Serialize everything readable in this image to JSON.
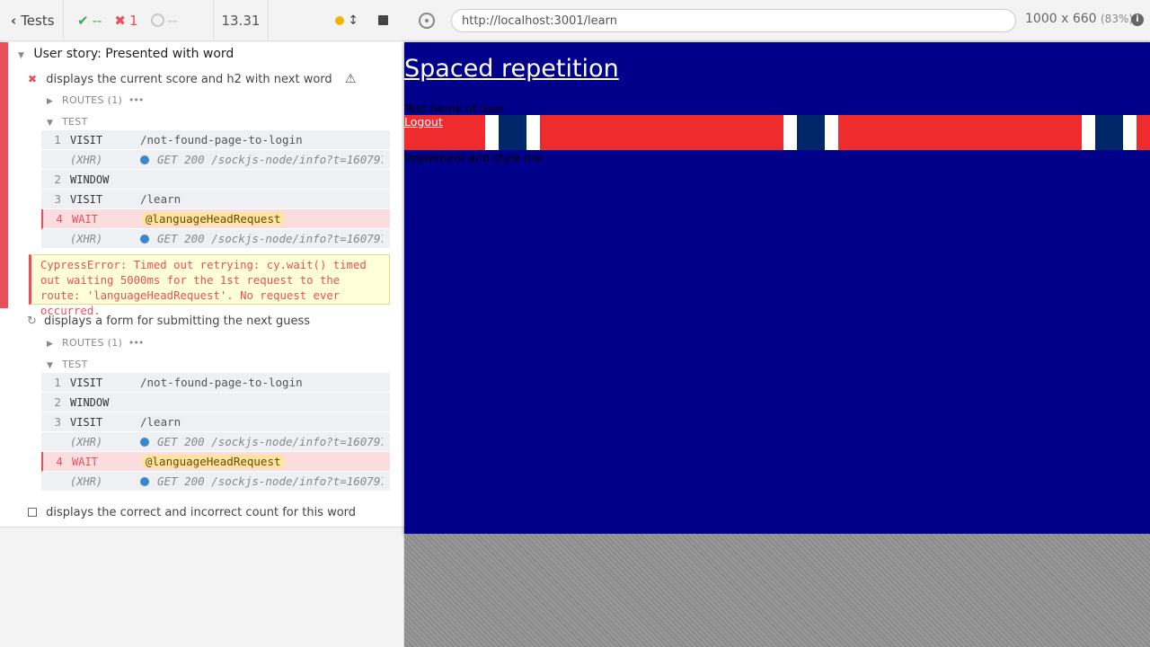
{
  "header": {
    "tests_label": "Tests",
    "passed": "--",
    "failed": "1",
    "pending": "--",
    "duration": "13.31"
  },
  "suite": {
    "title": "User story: Presented with word",
    "tests": [
      {
        "title": "displays the current score and h2 with next word",
        "state": "failed",
        "routes_label": "ROUTES (1)",
        "test_label": "TEST",
        "commands": [
          {
            "num": "1",
            "name": "VISIT",
            "message": "/not-found-page-to-login"
          },
          {
            "num": "",
            "name": "(XHR)",
            "message": "GET 200 /sockjs-node/info?t=160797…"
          },
          {
            "num": "2",
            "name": "WINDOW",
            "message": ""
          },
          {
            "num": "3",
            "name": "VISIT",
            "message": "/learn"
          },
          {
            "num": "4",
            "name": "WAIT",
            "message": "@languageHeadRequest"
          },
          {
            "num": "",
            "name": "(XHR)",
            "message": "GET 200 /sockjs-node/info?t=160797…"
          }
        ],
        "error": "CypressError: Timed out retrying: cy.wait() timed out waiting 5000ms for the 1st request to the route: 'languageHeadRequest'. No request ever occurred."
      },
      {
        "title": "displays a form for submitting the next guess",
        "state": "running",
        "routes_label": "ROUTES (1)",
        "test_label": "TEST",
        "commands": [
          {
            "num": "1",
            "name": "VISIT",
            "message": "/not-found-page-to-login"
          },
          {
            "num": "2",
            "name": "WINDOW",
            "message": ""
          },
          {
            "num": "3",
            "name": "VISIT",
            "message": "/learn"
          },
          {
            "num": "",
            "name": "(XHR)",
            "message": "GET 200 /sockjs-node/info?t=160797…"
          },
          {
            "num": "4",
            "name": "WAIT",
            "message": "@languageHeadRequest"
          },
          {
            "num": "",
            "name": "(XHR)",
            "message": "GET 200 /sockjs-node/info?t=160797…"
          }
        ]
      },
      {
        "title": "displays the correct and incorrect count for this word",
        "state": "pending"
      }
    ]
  },
  "aut": {
    "url": "http://localhost:3001/learn",
    "viewport": "1000 x 660",
    "scale": "(83%)",
    "app_title": "Spaced repetition",
    "user_name": "Test name of user",
    "logout": "Logout",
    "body_text": "Implement and style me",
    "background_color": "#00008b"
  }
}
